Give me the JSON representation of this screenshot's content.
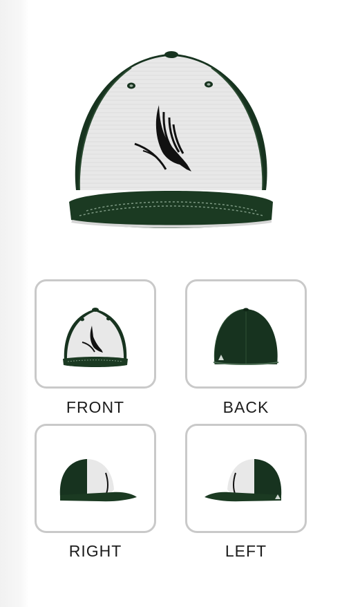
{
  "views": [
    {
      "key": "front",
      "label": "FRONT"
    },
    {
      "key": "back",
      "label": "BACK"
    },
    {
      "key": "right",
      "label": "RIGHT"
    },
    {
      "key": "left",
      "label": "LEFT"
    }
  ],
  "colors": {
    "crown_front": "#e7e7e7",
    "crown_sides": "#17331f",
    "brim": "#1b3a22",
    "logo": "#111111",
    "thumb_border": "#c9c9c9"
  },
  "icons": {
    "logo": "eagle-logo-icon",
    "brand_mark": "triangle-logo-icon"
  }
}
